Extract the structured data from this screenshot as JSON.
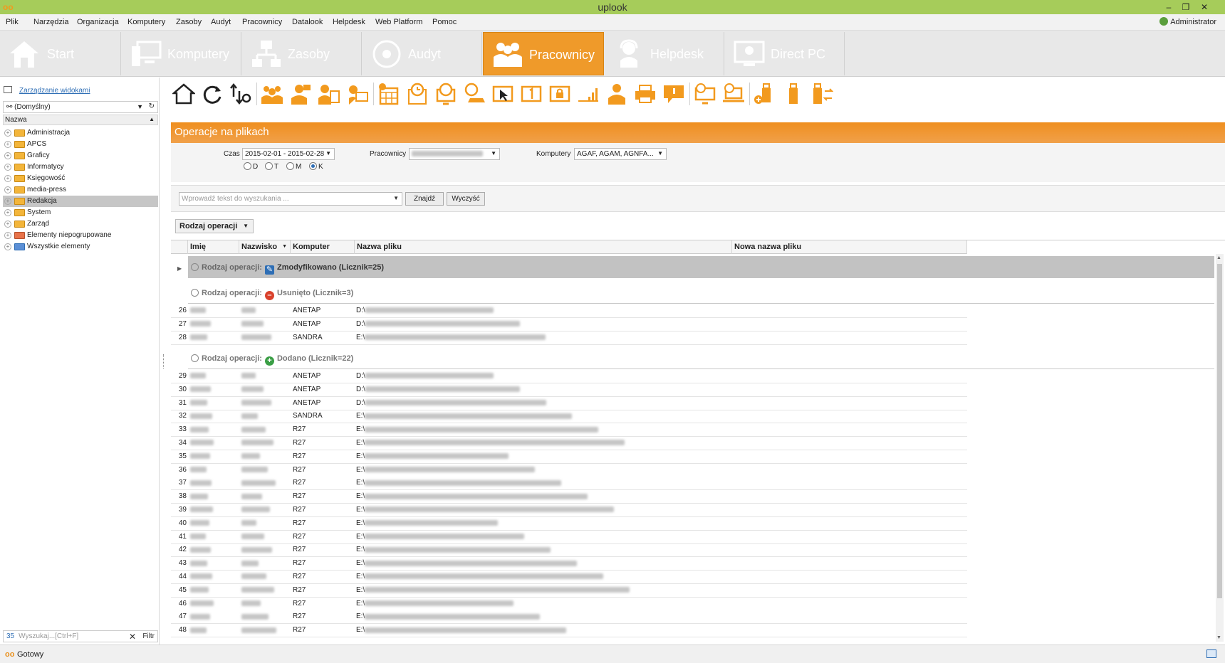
{
  "window": {
    "title": "uplook",
    "app_icon": "oo"
  },
  "menu": {
    "items": [
      "Plik",
      "Narzędzia",
      "Organizacja",
      "Komputery",
      "Zasoby",
      "Audyt",
      "Pracownicy",
      "Datalook",
      "Helpdesk",
      "Web Platform",
      "Pomoc"
    ],
    "user": "Administrator"
  },
  "ribbon": {
    "tabs": [
      {
        "label": "Start",
        "icon": "home-icon"
      },
      {
        "label": "Komputery",
        "icon": "computers-icon"
      },
      {
        "label": "Zasoby",
        "icon": "network-icon"
      },
      {
        "label": "Audyt",
        "icon": "audit-disc-icon"
      },
      {
        "label": "Pracownicy",
        "icon": "employees-icon",
        "active": true
      },
      {
        "label": "Helpdesk",
        "icon": "headset-icon"
      },
      {
        "label": "Direct PC",
        "icon": "remote-desktop-icon"
      }
    ],
    "accent": "#ef9a2a"
  },
  "left_panel": {
    "manage_link": "Zarządzanie widokami",
    "view_select": "(Domyślny)",
    "column_header": "Nazwa",
    "tree": [
      {
        "label": "Administracja",
        "type": "folder"
      },
      {
        "label": "APCS",
        "type": "folder"
      },
      {
        "label": "Graficy",
        "type": "folder"
      },
      {
        "label": "Informatycy",
        "type": "folder"
      },
      {
        "label": "Księgowość",
        "type": "folder"
      },
      {
        "label": "media-press",
        "type": "folder"
      },
      {
        "label": "Redakcja",
        "type": "folder",
        "selected": true
      },
      {
        "label": "System",
        "type": "folder"
      },
      {
        "label": "Zarząd",
        "type": "folder"
      },
      {
        "label": "Elementy niepogrupowane",
        "type": "ungrouped"
      },
      {
        "label": "Wszystkie elementy",
        "type": "all"
      }
    ],
    "search": {
      "count": "35",
      "placeholder": "Wyszukaj...[Ctrl+F]",
      "clear": "✕",
      "filter": "Filtr"
    }
  },
  "toolbar": {
    "icons": [
      "home-icon",
      "refresh-icon",
      "sort-settings-icon",
      "group-users-icon",
      "user-lock-icon",
      "user-documents-icon",
      "user-settings-icon",
      "calendar-add-icon",
      "clock-calendar-icon",
      "clock-monitor-icon",
      "clock-laptop-icon",
      "cursor-window-icon",
      "counter-icon",
      "lock-window-icon",
      "bandwidth-icon",
      "user-orange-icon",
      "printer-icon",
      "chat-bubble-icon",
      "www-monitor-icon",
      "www-laptop-icon",
      "usb-add-icon",
      "usb-icon",
      "usb-transfer-icon"
    ]
  },
  "operation": {
    "title": "Operacje na plikach",
    "filters": {
      "time_label": "Czas",
      "time_value": "2015-02-01 - 2015-02-28",
      "employees_label": "Pracownicy",
      "computers_label": "Komputery",
      "computers_value": "AGAF, AGAM, AGNFA...",
      "period_options": [
        "D",
        "T",
        "M",
        "K"
      ],
      "period_selected": "K"
    },
    "search": {
      "placeholder": "Wprowadź tekst do wyszukania ...",
      "find": "Znajdź",
      "clear": "Wyczyść"
    },
    "group_by": "Rodzaj operacji"
  },
  "grid": {
    "columns": [
      "Imię",
      "Nazwisko",
      "Komputer",
      "Nazwa pliku",
      "Nowa nazwa pliku"
    ],
    "groups": [
      {
        "label": "Rodzaj operacji:",
        "value": "Zmodyfikowano (Licznik=25)",
        "badge": "modify",
        "collapsed": true,
        "rows": []
      },
      {
        "label": "Rodzaj operacji:",
        "value": "Usunięto (Licznik=3)",
        "badge": "delete",
        "rows": [
          {
            "n": "26",
            "computer": "ANETAP",
            "file": "D:\\"
          },
          {
            "n": "27",
            "computer": "ANETAP",
            "file": "D:\\"
          },
          {
            "n": "28",
            "computer": "SANDRA",
            "file": "E:\\"
          }
        ]
      },
      {
        "label": "Rodzaj operacji:",
        "value": "Dodano (Licznik=22)",
        "badge": "add",
        "rows": [
          {
            "n": "29",
            "computer": "ANETAP",
            "file": "D:\\"
          },
          {
            "n": "30",
            "computer": "ANETAP",
            "file": "D:\\"
          },
          {
            "n": "31",
            "computer": "ANETAP",
            "file": "D:\\"
          },
          {
            "n": "32",
            "computer": "SANDRA",
            "file": "E:\\"
          },
          {
            "n": "33",
            "computer": "R27",
            "file": "E:\\"
          },
          {
            "n": "34",
            "computer": "R27",
            "file": "E:\\"
          },
          {
            "n": "35",
            "computer": "R27",
            "file": "E:\\"
          },
          {
            "n": "36",
            "computer": "R27",
            "file": "E:\\"
          },
          {
            "n": "37",
            "computer": "R27",
            "file": "E:\\"
          },
          {
            "n": "38",
            "computer": "R27",
            "file": "E:\\"
          },
          {
            "n": "39",
            "computer": "R27",
            "file": "E:\\"
          },
          {
            "n": "40",
            "computer": "R27",
            "file": "E:\\"
          },
          {
            "n": "41",
            "computer": "R27",
            "file": "E:\\"
          },
          {
            "n": "42",
            "computer": "R27",
            "file": "E:\\"
          },
          {
            "n": "43",
            "computer": "R27",
            "file": "E:\\"
          },
          {
            "n": "44",
            "computer": "R27",
            "file": "E:\\"
          },
          {
            "n": "45",
            "computer": "R27",
            "file": "E:\\"
          },
          {
            "n": "46",
            "computer": "R27",
            "file": "E:\\"
          },
          {
            "n": "47",
            "computer": "R27",
            "file": "E:\\"
          },
          {
            "n": "48",
            "computer": "R27",
            "file": "E:\\"
          }
        ]
      }
    ]
  },
  "status": {
    "text": "Gotowy"
  }
}
